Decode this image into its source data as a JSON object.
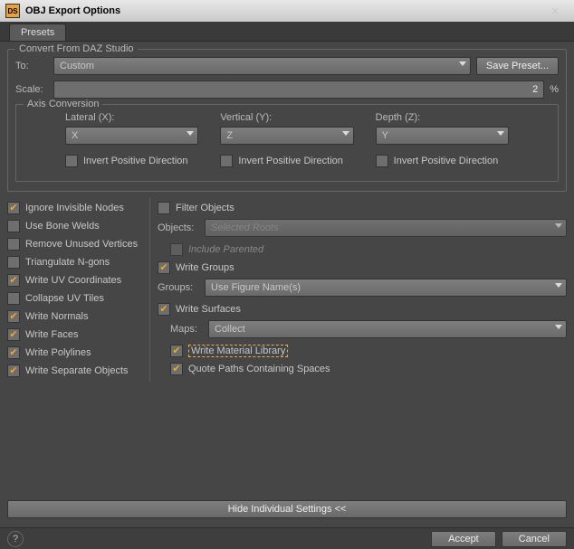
{
  "window": {
    "title": "OBJ Export Options",
    "icon_text": "DS"
  },
  "tabs": {
    "presets": "Presets"
  },
  "convert": {
    "legend": "Convert From DAZ Studio",
    "to_label": "To:",
    "to_value": "Custom",
    "save_preset": "Save Preset...",
    "scale_label": "Scale:",
    "scale_value": "2",
    "scale_unit": "%"
  },
  "axis": {
    "legend": "Axis Conversion",
    "lateral_label": "Lateral (X):",
    "lateral_value": "X",
    "vertical_label": "Vertical (Y):",
    "vertical_value": "Z",
    "depth_label": "Depth (Z):",
    "depth_value": "Y",
    "invert_label": "Invert Positive Direction"
  },
  "left_opts": {
    "ignore_invisible": "Ignore Invisible Nodes",
    "use_bone_welds": "Use Bone Welds",
    "remove_unused": "Remove Unused Vertices",
    "triangulate": "Triangulate N-gons",
    "write_uv": "Write UV Coordinates",
    "collapse_uv": "Collapse UV Tiles",
    "write_normals": "Write Normals",
    "write_faces": "Write Faces",
    "write_polylines": "Write Polylines",
    "write_separate": "Write Separate Objects"
  },
  "right_opts": {
    "filter_objects": "Filter Objects",
    "objects_label": "Objects:",
    "objects_value": "Selected Roots",
    "include_parented": "Include Parented",
    "write_groups": "Write Groups",
    "groups_label": "Groups:",
    "groups_value": "Use Figure Name(s)",
    "write_surfaces": "Write Surfaces",
    "maps_label": "Maps:",
    "maps_value": "Collect",
    "write_mtl": "Write Material Library",
    "quote_paths": "Quote Paths Containing Spaces"
  },
  "hide_settings": "Hide Individual Settings <<",
  "footer": {
    "accept": "Accept",
    "cancel": "Cancel",
    "help": "?"
  }
}
